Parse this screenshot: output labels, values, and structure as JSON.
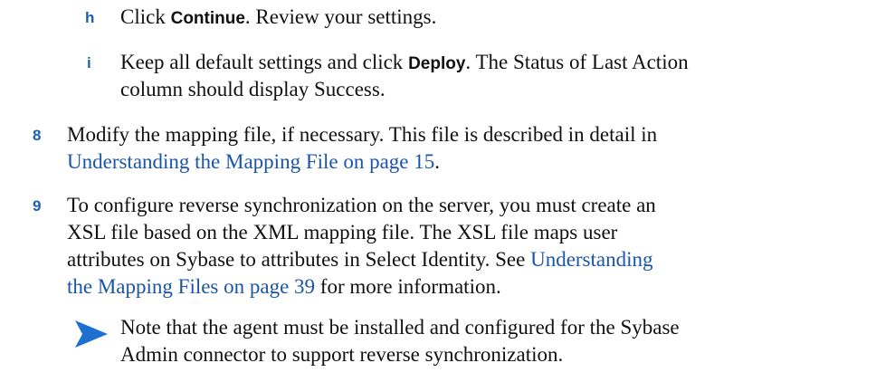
{
  "steps": {
    "h": {
      "label": "h",
      "pre": "Click ",
      "button": "Continue",
      "post": ". Review your settings."
    },
    "i": {
      "label": "i",
      "line1_pre": "Keep all default settings and click ",
      "button": "Deploy",
      "line1_post": ". The Status of Last Action",
      "line2": "column should display Success."
    },
    "s8": {
      "label": "8",
      "line1": "Modify the mapping file, if necessary. This file is described in detail in",
      "link": "Understanding the Mapping File on page 15",
      "line2_post": "."
    },
    "s9": {
      "label": "9",
      "line1": "To configure reverse synchronization on the server, you must create an",
      "line2": "XSL file based on the XML mapping file. The XSL file maps user",
      "line3_pre": "attributes on Sybase to attributes in Select Identity. See ",
      "link_part1": "Understanding",
      "link_part2": "the Mapping Files on page 39",
      "line4_post": " for more information."
    }
  },
  "note": {
    "line1": "Note that the agent must be installed and configured for the Sybase",
    "line2": "Admin connector to support reverse synchronization."
  }
}
